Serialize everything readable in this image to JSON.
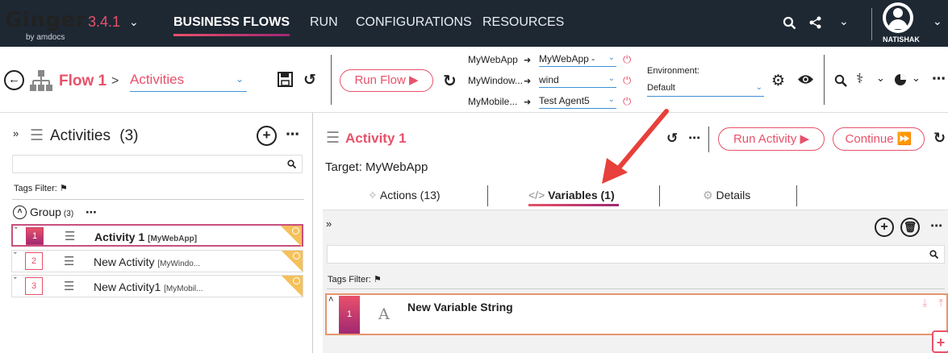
{
  "app": {
    "name": "Ginger",
    "subtitle": "by amdocs",
    "version": "3.4.1",
    "nav": [
      "BUSINESS FLOWS",
      "RUN",
      "CONFIGURATIONS",
      "RESOURCES"
    ],
    "user": "NATISHAK",
    "accent_color": "#e8516a",
    "nav_bg": "#1e2833"
  },
  "toolbar": {
    "flow_title": "Flow 1",
    "crumb_sep": ">",
    "activities_select": "Activities",
    "run_flow_label": "Run Flow",
    "agents": [
      {
        "label": "MyWebApp",
        "value": "MyWebApp -"
      },
      {
        "label": "MyWindow...",
        "value": "wind"
      },
      {
        "label": "MyMobile...",
        "value": "Test Agent5"
      }
    ],
    "environment_label": "Environment:",
    "environment_value": "Default"
  },
  "left": {
    "title": "Activities",
    "count": "(3)",
    "tags_filter": "Tags Filter:",
    "group_label": "Group",
    "group_count": "(3)",
    "activities": [
      {
        "num": "1",
        "name": "Activity 1",
        "target": "[MyWebApp]",
        "selected": true
      },
      {
        "num": "2",
        "name": "New Activity",
        "target": "[MyWindo...",
        "selected": false
      },
      {
        "num": "3",
        "name": "New Activity1",
        "target": "[MyMobil...",
        "selected": false
      }
    ]
  },
  "right": {
    "activity_title": "Activity 1",
    "run_activity_label": "Run Activity",
    "continue_label": "Continue",
    "target": "Target: MyWebApp",
    "tabs": [
      "Actions (13)",
      "Variables (1)",
      "Details"
    ],
    "tags_filter": "Tags Filter:",
    "variables": [
      {
        "num": "1",
        "icon": "A",
        "name": "New Variable String"
      }
    ]
  }
}
